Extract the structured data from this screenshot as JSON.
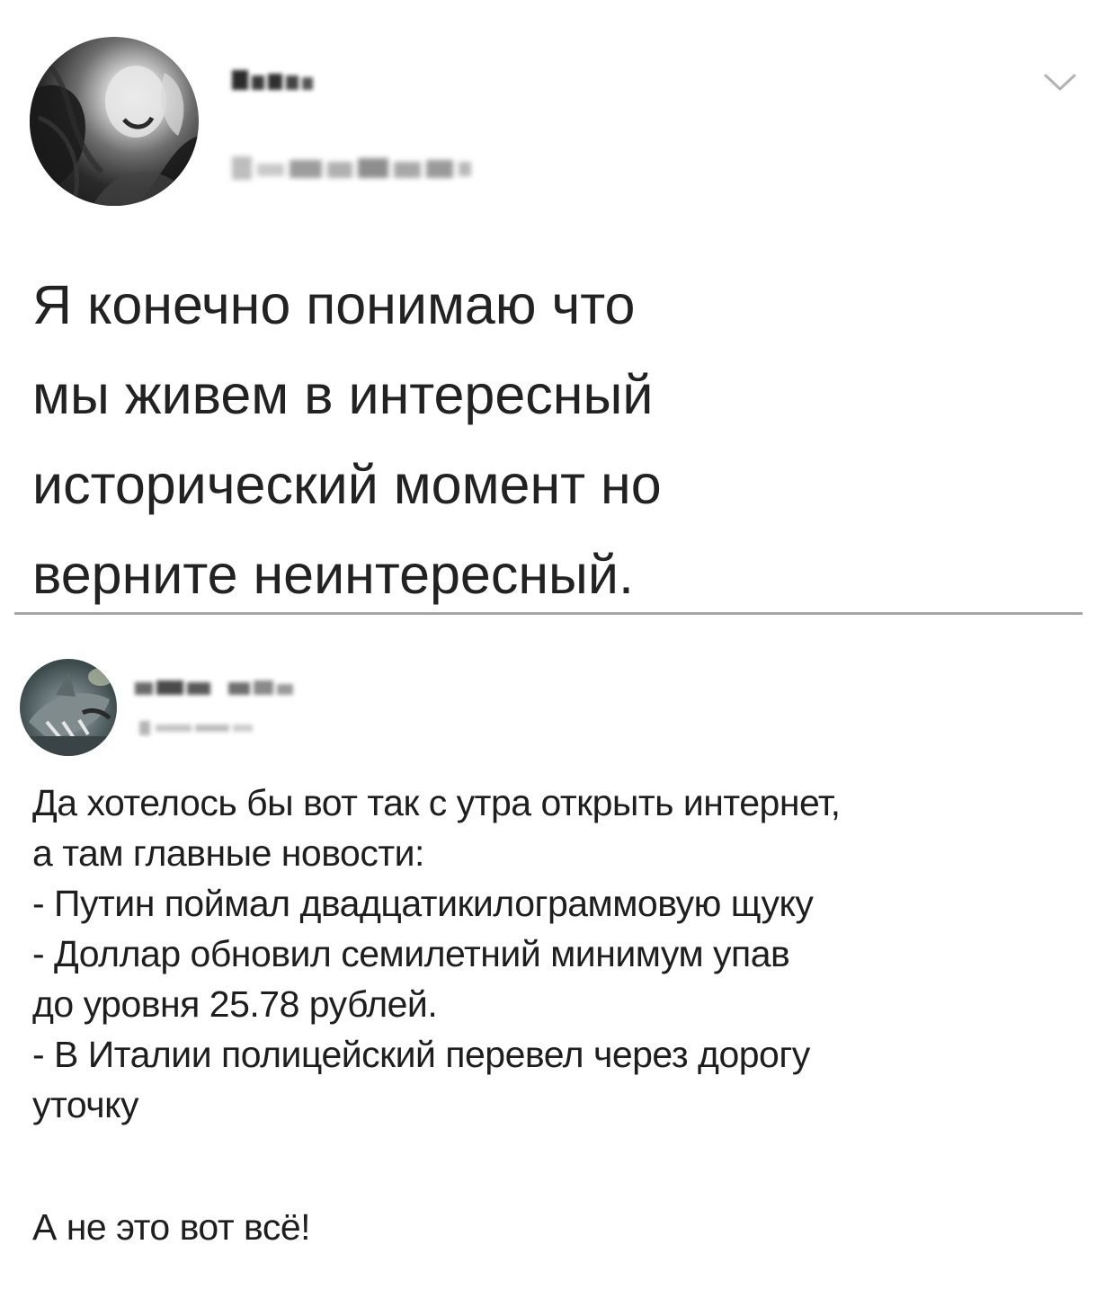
{
  "post": {
    "author_name_blurred": true,
    "author_handle_blurred": true,
    "menu_icon": "chevron-down-icon",
    "text": "Я конечно понимаю что\nмы живем в интересный\nисторический момент но\nверните неинтересный."
  },
  "comment": {
    "author_name_blurred": true,
    "author_handle_blurred": true,
    "lines": [
      "Да хотелось бы вот так с утра открыть интернет,",
      "а там главные новости:",
      "- Путин поймал двадцатикилограммовую щуку",
      "- Доллар обновил семилетний минимум упав",
      "до уровня 25.78 рублей.",
      "- В Италии полицейский перевел через дорогу",
      "уточку"
    ],
    "footer": "А не это вот всё!"
  },
  "colors": {
    "text": "#222222",
    "divider": "#a6a6a6",
    "chevron": "#b3b3b3"
  }
}
